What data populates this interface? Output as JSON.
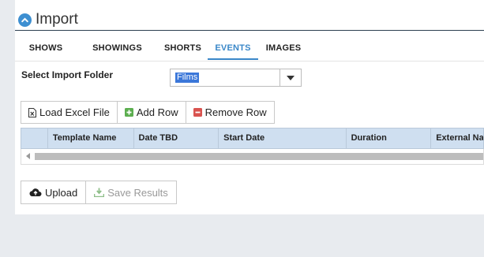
{
  "page": {
    "title": "Import",
    "title_icon": "chevron-up-circle-icon",
    "accent_color": "#3a87c8"
  },
  "tabs": [
    {
      "label": "SHOWS",
      "active": false
    },
    {
      "label": "SHOWINGS",
      "active": false
    },
    {
      "label": "SHORTS",
      "active": false
    },
    {
      "label": "EVENTS",
      "active": true
    },
    {
      "label": "IMAGES",
      "active": false
    }
  ],
  "import_folder": {
    "label": "Select Import Folder",
    "selected_value": "Films"
  },
  "toolbar": {
    "load_excel_label": "Load Excel File",
    "add_row_label": "Add Row",
    "remove_row_label": "Remove Row"
  },
  "grid": {
    "columns": [
      "Template Name",
      "Date TBD",
      "Start Date",
      "Duration",
      "External Na"
    ],
    "rows": []
  },
  "actions": {
    "upload_label": "Upload",
    "save_results_label": "Save Results",
    "save_results_disabled": true
  }
}
